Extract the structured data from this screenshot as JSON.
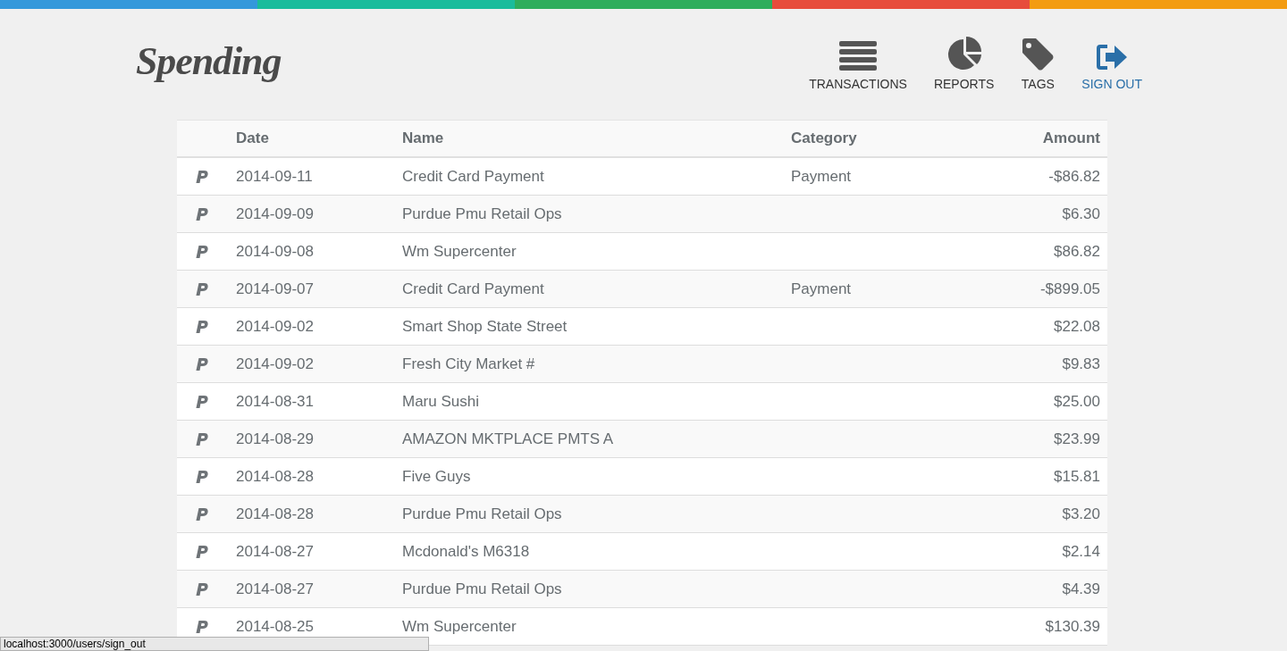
{
  "logo": "Spending",
  "nav": [
    {
      "kind": "list",
      "label": "TRANSACTIONS",
      "selected": false
    },
    {
      "kind": "pie",
      "label": "REPORTS",
      "selected": false
    },
    {
      "kind": "tag",
      "label": "TAGS",
      "selected": false
    },
    {
      "kind": "signout",
      "label": "SIGN OUT",
      "selected": true
    }
  ],
  "table": {
    "columns": [
      "Date",
      "Name",
      "Category",
      "Amount"
    ],
    "rows": [
      {
        "date": "2014-09-11",
        "name": "Credit Card Payment",
        "category": "Payment",
        "amount": "-$86.82"
      },
      {
        "date": "2014-09-09",
        "name": "Purdue Pmu Retail Ops",
        "amount": "$6.30"
      },
      {
        "date": "2014-09-08",
        "name": "Wm Supercenter",
        "amount": "$86.82"
      },
      {
        "date": "2014-09-07",
        "name": "Credit Card Payment",
        "category": "Payment",
        "amount": "-$899.05"
      },
      {
        "date": "2014-09-02",
        "name": "Smart Shop State Street",
        "amount": "$22.08"
      },
      {
        "date": "2014-09-02",
        "name": "Fresh City Market #",
        "amount": "$9.83"
      },
      {
        "date": "2014-08-31",
        "name": "Maru Sushi",
        "amount": "$25.00"
      },
      {
        "date": "2014-08-29",
        "name": "AMAZON MKTPLACE PMTS A",
        "amount": "$23.99"
      },
      {
        "date": "2014-08-28",
        "name": "Five Guys",
        "amount": "$15.81"
      },
      {
        "date": "2014-08-28",
        "name": "Purdue Pmu Retail Ops",
        "amount": "$3.20"
      },
      {
        "date": "2014-08-27",
        "name": "Mcdonald's M6318",
        "amount": "$2.14"
      },
      {
        "date": "2014-08-27",
        "name": "Purdue Pmu Retail Ops",
        "amount": "$4.39"
      },
      {
        "date": "2014-08-25",
        "name": "Wm Supercenter",
        "amount": "$130.39"
      }
    ]
  },
  "status_bar": "localhost:3000/users/sign_out"
}
